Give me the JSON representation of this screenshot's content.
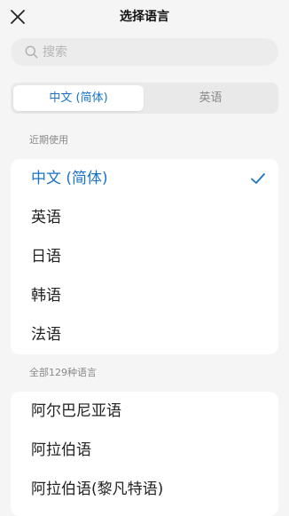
{
  "header": {
    "title": "选择语言"
  },
  "search": {
    "placeholder": "搜索"
  },
  "tabs": [
    {
      "label": "中文 (简体)"
    },
    {
      "label": "英语"
    }
  ],
  "recent": {
    "label": "近期使用",
    "items": [
      {
        "label": "中文 (简体)"
      },
      {
        "label": "英语"
      },
      {
        "label": "日语"
      },
      {
        "label": "韩语"
      },
      {
        "label": "法语"
      }
    ]
  },
  "all": {
    "label": "全部129种语言",
    "items": [
      {
        "label": "阿尔巴尼亚语"
      },
      {
        "label": "阿拉伯语"
      },
      {
        "label": "阿拉伯语(黎凡特语)"
      }
    ]
  },
  "icons": {
    "close": "close-icon",
    "search": "search-icon",
    "check": "checkmark-icon"
  },
  "colors": {
    "accent": "#1a73c8",
    "background": "#f5f5f5"
  }
}
